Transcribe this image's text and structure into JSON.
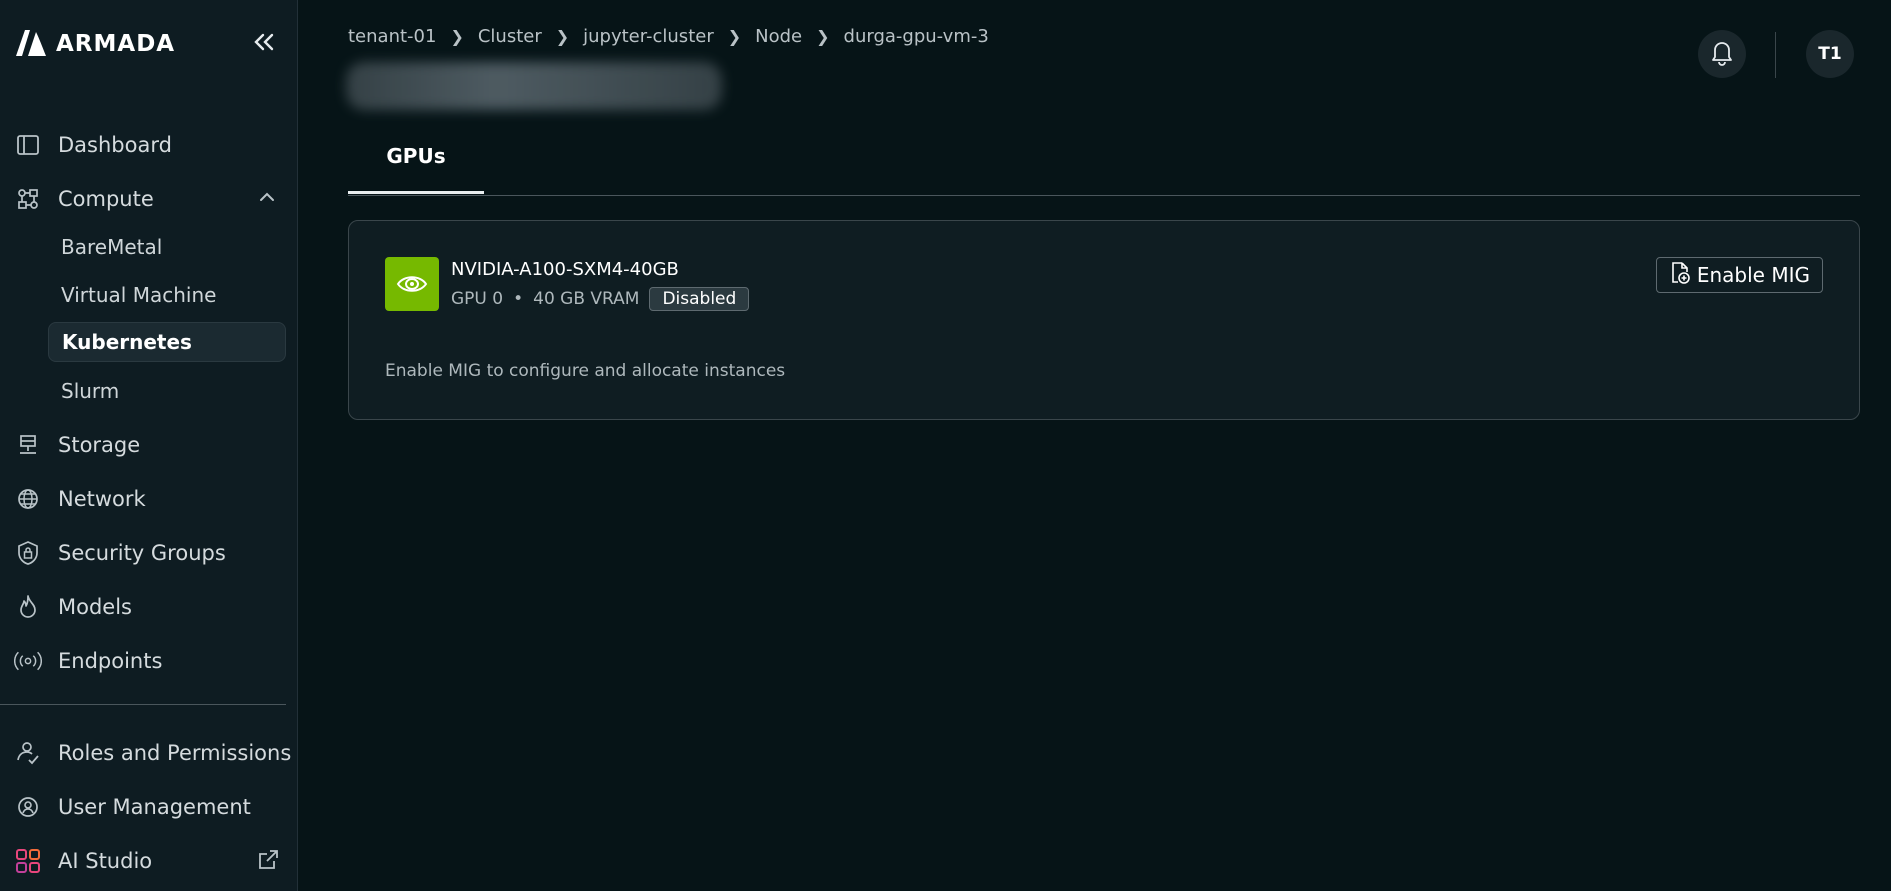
{
  "brand": {
    "name": "ARMADA"
  },
  "sidebar": {
    "items": [
      {
        "label": "Dashboard",
        "icon": "dashboard-icon"
      },
      {
        "label": "Compute",
        "icon": "compute-icon",
        "expanded": true,
        "children": [
          {
            "label": "BareMetal"
          },
          {
            "label": "Virtual Machine"
          },
          {
            "label": "Kubernetes",
            "active": true
          },
          {
            "label": "Slurm"
          }
        ]
      },
      {
        "label": "Storage",
        "icon": "storage-icon"
      },
      {
        "label": "Network",
        "icon": "globe-icon"
      },
      {
        "label": "Security Groups",
        "icon": "shield-lock-icon"
      },
      {
        "label": "Models",
        "icon": "flame-icon"
      },
      {
        "label": "Endpoints",
        "icon": "broadcast-icon"
      }
    ],
    "footer_items": [
      {
        "label": "Roles and Permissions",
        "icon": "users-check-icon"
      },
      {
        "label": "User Management",
        "icon": "user-gear-icon"
      },
      {
        "label": "AI Studio",
        "icon": "apps-grid-icon",
        "external": true
      }
    ]
  },
  "breadcrumb": [
    "tenant-01",
    "Cluster",
    "jupyter-cluster",
    "Node",
    "durga-gpu-vm-3"
  ],
  "header": {
    "avatar_initials": "T1"
  },
  "tabs": [
    {
      "label": "GPUs",
      "active": true
    }
  ],
  "gpu_card": {
    "name": "NVIDIA-A100-SXM4-40GB",
    "gpu_index": "GPU 0",
    "separator": "•",
    "vram": "40 GB VRAM",
    "status": "Disabled",
    "action_label": "Enable MIG",
    "hint": "Enable MIG to configure and allocate instances"
  },
  "colors": {
    "background": "#061417",
    "sidebar": "#0e1c22",
    "nvidia_green": "#76b900"
  }
}
